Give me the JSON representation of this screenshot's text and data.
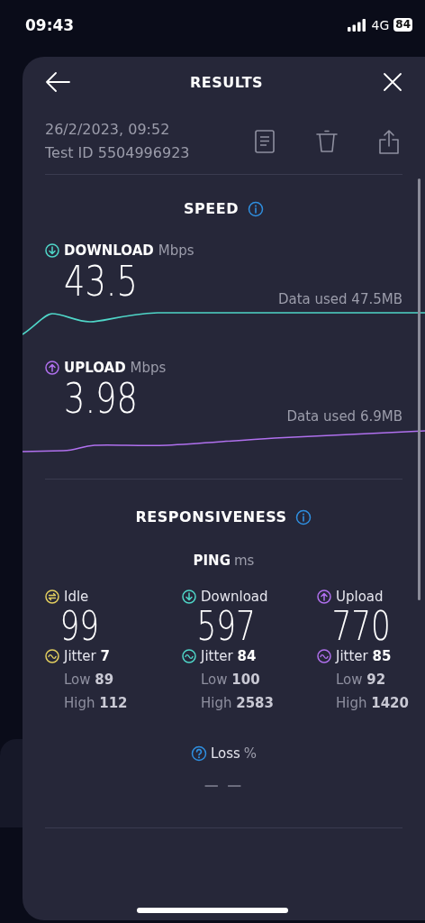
{
  "status_bar": {
    "time": "09:43",
    "network": "4G",
    "battery": "84"
  },
  "header": {
    "title": "RESULTS"
  },
  "test": {
    "date": "26/2/2023, 09:52",
    "test_id": "Test ID 5504996923"
  },
  "speed": {
    "title": "SPEED",
    "metrics": [
      {
        "kind": "download",
        "label": "DOWNLOAD",
        "unit": "Mbps",
        "value": "43.5",
        "data_used": "Data used 47.5MB"
      },
      {
        "kind": "upload",
        "label": "UPLOAD",
        "unit": "Mbps",
        "value": "3.98",
        "data_used": "Data used 6.9MB"
      }
    ]
  },
  "responsiveness": {
    "title": "RESPONSIVENESS",
    "ping": {
      "label": "PING",
      "unit": "ms"
    },
    "columns": [
      {
        "kind": "idle",
        "label": "Idle",
        "value": "99",
        "jitter": "Jitter **7**",
        "low": "Low **89**",
        "high": "High **112**"
      },
      {
        "kind": "download",
        "label": "Download",
        "value": "597",
        "jitter": "Jitter **84**",
        "low": "Low **100**",
        "high": "High **2583**"
      },
      {
        "kind": "upload",
        "label": "Upload",
        "value": "770",
        "jitter": "Jitter **85**",
        "low": "Low **92**",
        "high": "High **1420**"
      }
    ],
    "loss": {
      "label": "Loss",
      "unit": "%",
      "value": "— —"
    }
  }
}
